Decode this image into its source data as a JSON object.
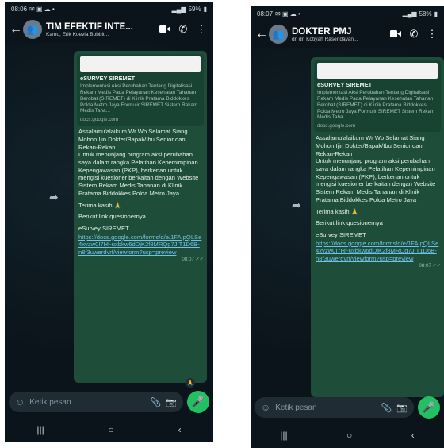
{
  "phones": [
    {
      "status_time": "08:06",
      "status_battery": "59%",
      "chat_title": "TIM EFEKTIF INTE...",
      "chat_subtitle": "Kamu, Erik Koevia Bobbit...",
      "preview_title": "eSURVEY SIREMET",
      "preview_desc": "Implementasi Aksi Perubahan Tentang Digitalisasi Rekam Medis Pada Pelayanan Kesehatan Tahanan Berobat (SIREMET) di Klinik Pratama Biddokkes Polda Metro Jaya Formulir SIREMET Sistem Rekam Medis Taha...",
      "preview_url": "docs.google.com",
      "message_paragraphs": [
        "Assalamu'alaikum Wr Wb Selamat Siang Mohon Ijin Dokter/Bapak/Ibu Senior dan Rekan-Rekan\nUntuk menunjang program aksi perubahan saya dalam rangka Pelatihan Kepemimpinan Kepengawasan (PKP), berkenan untuk mengisi kuesioner berkaitan dengan Website Sistem Rekam Medis Tahanan di Klinik Pratama Biddokkes Polda Metro Jaya",
        "Terima kasih 🙏",
        "Berikut link quesionernya",
        "eSurvey SIREMET"
      ],
      "link": "https://docs.google.com/forms/d/e/1FAIpQLSe4xyzw0I7Hf-uxbkw6dDjK2f8MRQg7JIT1D6B-n8f3uwerdvrf/viewform?usp=preview",
      "time": "08:07",
      "reaction": "🙏",
      "input_placeholder": "Ketik pesan"
    },
    {
      "status_time": "08:07",
      "status_battery": "58%",
      "chat_title": "DOKTER PMJ",
      "chat_subtitle": "dr. dr. Kotiyah Rasendayan...",
      "preview_title": "eSURVEY SIREMET",
      "preview_desc": "Implementasi Aksi Perubahan Tentang Digitalisasi Rekam Medis Pada Pelayanan Kesehatan Tahanan Berobat (SIREMET) di Klinik Pratama Biddokkes Polda Metro Jaya Formulir SIREMET Sistem Rekam Medis Taha...",
      "preview_url": "docs.google.com",
      "message_paragraphs": [
        "Assalamu'alaikum Wr Wb Selamat Siang Mohon Ijin Dokter/Bapak/Ibu Senior dan Rekan-Rekan\nUntuk menunjang program aksi perubahan saya dalam rangka Pelatihan Kepemimpinan Kepengawasan (PKP), berkenan untuk mengisi kuesioner berkaitan dengan Website Sistem Rekam Medis Tahanan di Klinik Pratama Biddokkes Polda Metro Jaya",
        "Terima kasih 🙏",
        "Berikut link quesionernya",
        "eSurvey SIREMET"
      ],
      "link": "https://docs.google.com/forms/d/e/1FAIpQLSe4xyzw0I7Hf-uxbkw6dDjK2f8MRQg7JIT1D6B-n8f3uwerdvrf/viewform?usp=preview",
      "time": "08:07",
      "reaction": "",
      "input_placeholder": "Ketik pesan"
    }
  ]
}
